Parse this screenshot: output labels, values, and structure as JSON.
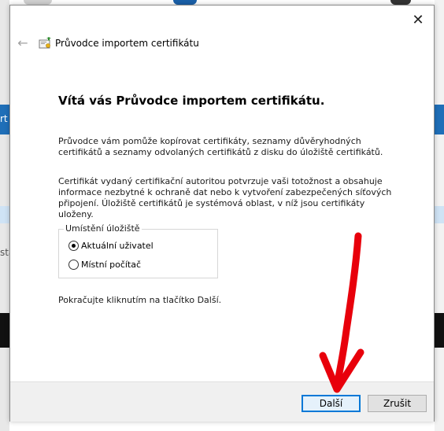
{
  "background": {
    "left_text_1": "rt",
    "left_text_2": "sta"
  },
  "dialog": {
    "title": "Průvodce importem certifikátu",
    "close_glyph": "✕",
    "back_glyph": "←",
    "heading": "Vítá vás Průvodce importem certifikátu.",
    "intro": "Průvodce vám pomůže kopírovat certifikáty, seznamy důvěryhodných certifikátů a seznamy odvolaných certifikátů z disku do úložiště certifikátů.",
    "description": "Certifikát vydaný certifikační autoritou potvrzuje vaši totožnost a obsahuje informace nezbytné k ochraně dat nebo k vytvoření zabezpečených síťových připojení. Úložiště certifikátů je systémová oblast, v níž jsou certifikáty uloženy.",
    "store_location": {
      "label": "Umístění úložiště",
      "options": [
        {
          "label": "Aktuální uživatel",
          "selected": true
        },
        {
          "label": "Místní počítač",
          "selected": false
        }
      ]
    },
    "continue_text": "Pokračujte kliknutím na tlačítko Další.",
    "buttons": {
      "next": "Další",
      "cancel": "Zrušit"
    }
  },
  "annotation": {
    "arrow_color": "#e8000b"
  },
  "icons": {
    "close": "close-icon",
    "back": "back-arrow-icon",
    "wizard": "certificate-wizard-icon"
  }
}
